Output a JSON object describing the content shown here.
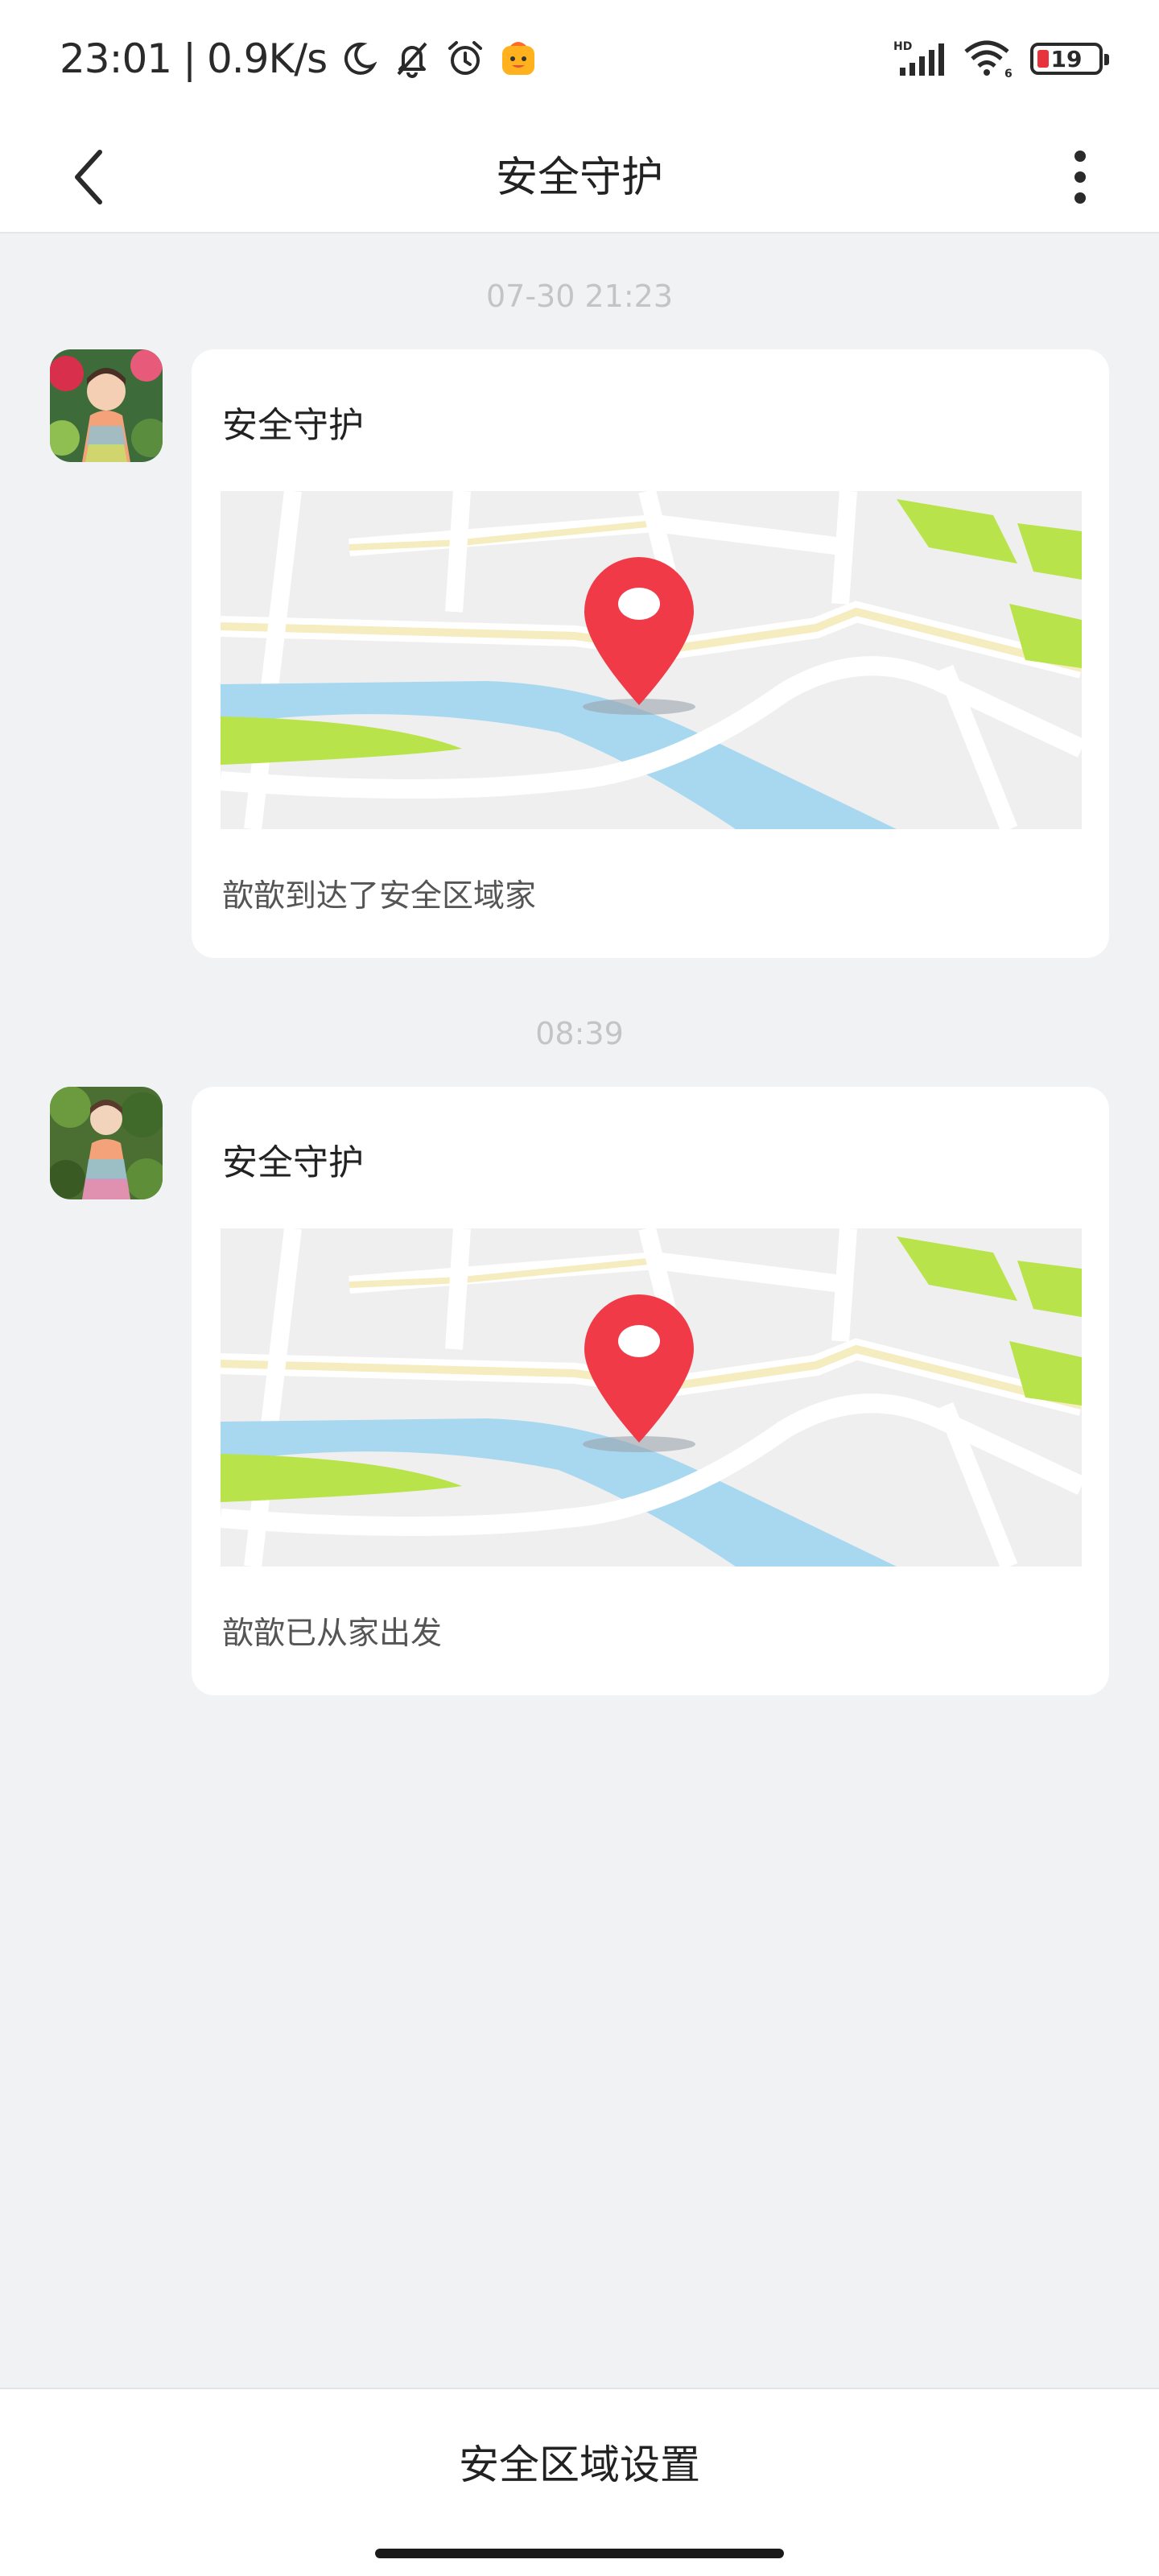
{
  "status_bar": {
    "time": "23:01",
    "separator": "|",
    "net_speed": "0.9K/s",
    "icons": [
      "moon-icon",
      "mute-icon",
      "alarm-icon",
      "emoji-icon"
    ],
    "signal_label": "HD",
    "wifi_sub": "6",
    "battery_level": "19",
    "battery_fraction": 0.19,
    "battery_color": "#e8323c"
  },
  "nav": {
    "title": "安全守护",
    "back_icon": "chevron-left-icon",
    "more_icon": "more-vertical-icon"
  },
  "messages": [
    {
      "time": "07-30 21:23",
      "title": "安全守护",
      "text": "歆歆到达了安全区域家"
    },
    {
      "time": "08:39",
      "title": "安全守护",
      "text": "歆歆已从家出发"
    }
  ],
  "colors": {
    "pin": "#f03a47",
    "river": "#a8d8f0",
    "park": "#b9e34a",
    "road_major": "#f5ecc0",
    "map_bg": "#efefef"
  },
  "bottom": {
    "label": "安全区域设置"
  }
}
